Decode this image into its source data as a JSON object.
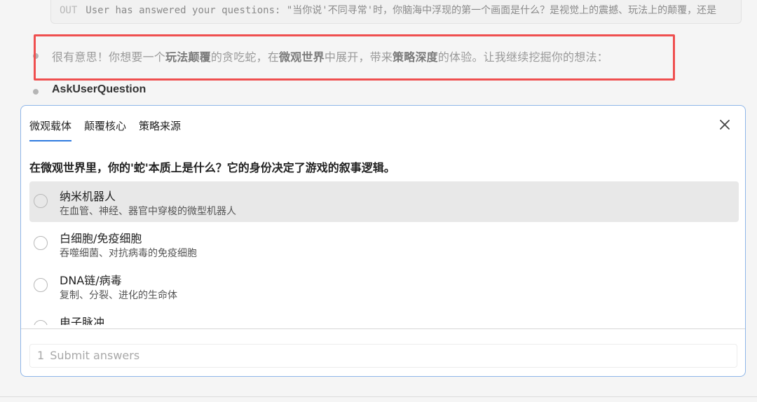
{
  "log": {
    "tag": "OUT",
    "text": "User has answered your questions: \"当你说'不同寻常'时，你脑海中浮现的第一个画面是什么？是视觉上的震撼、玩法上的颠覆，还是"
  },
  "message": {
    "p1": "很有意思！你想要一个",
    "b1": "玩法颠覆",
    "p2": "的贪吃蛇，在",
    "b2": "微观世界",
    "p3": "中展开，带来",
    "b3": "策略深度",
    "p4": "的体验。让我继续挖掘你的想法："
  },
  "tool": {
    "name": "AskUserQuestion"
  },
  "dialog": {
    "tabs": [
      "微观载体",
      "颠覆核心",
      "策略来源"
    ],
    "active_tab": 0,
    "question": "在微观世界里，你的'蛇'本质上是什么？它的身份决定了游戏的叙事逻辑。",
    "options": [
      {
        "label": "纳米机器人",
        "desc": "在血管、神经、器官中穿梭的微型机器人"
      },
      {
        "label": "白细胞/免疫细胞",
        "desc": "吞噬细菌、对抗病毒的免疫细胞"
      },
      {
        "label": "DNA链/病毒",
        "desc": "复制、分裂、进化的生命体"
      },
      {
        "label": "电子脉冲",
        "desc": ""
      }
    ],
    "submit": {
      "count": "1",
      "label": "Submit answers"
    }
  },
  "colors": {
    "highlight_border": "#ef4f4f",
    "active_tab_underline": "#2f7be0",
    "panel_border": "#8fb6e8"
  },
  "icons": {
    "close": "close-icon"
  }
}
